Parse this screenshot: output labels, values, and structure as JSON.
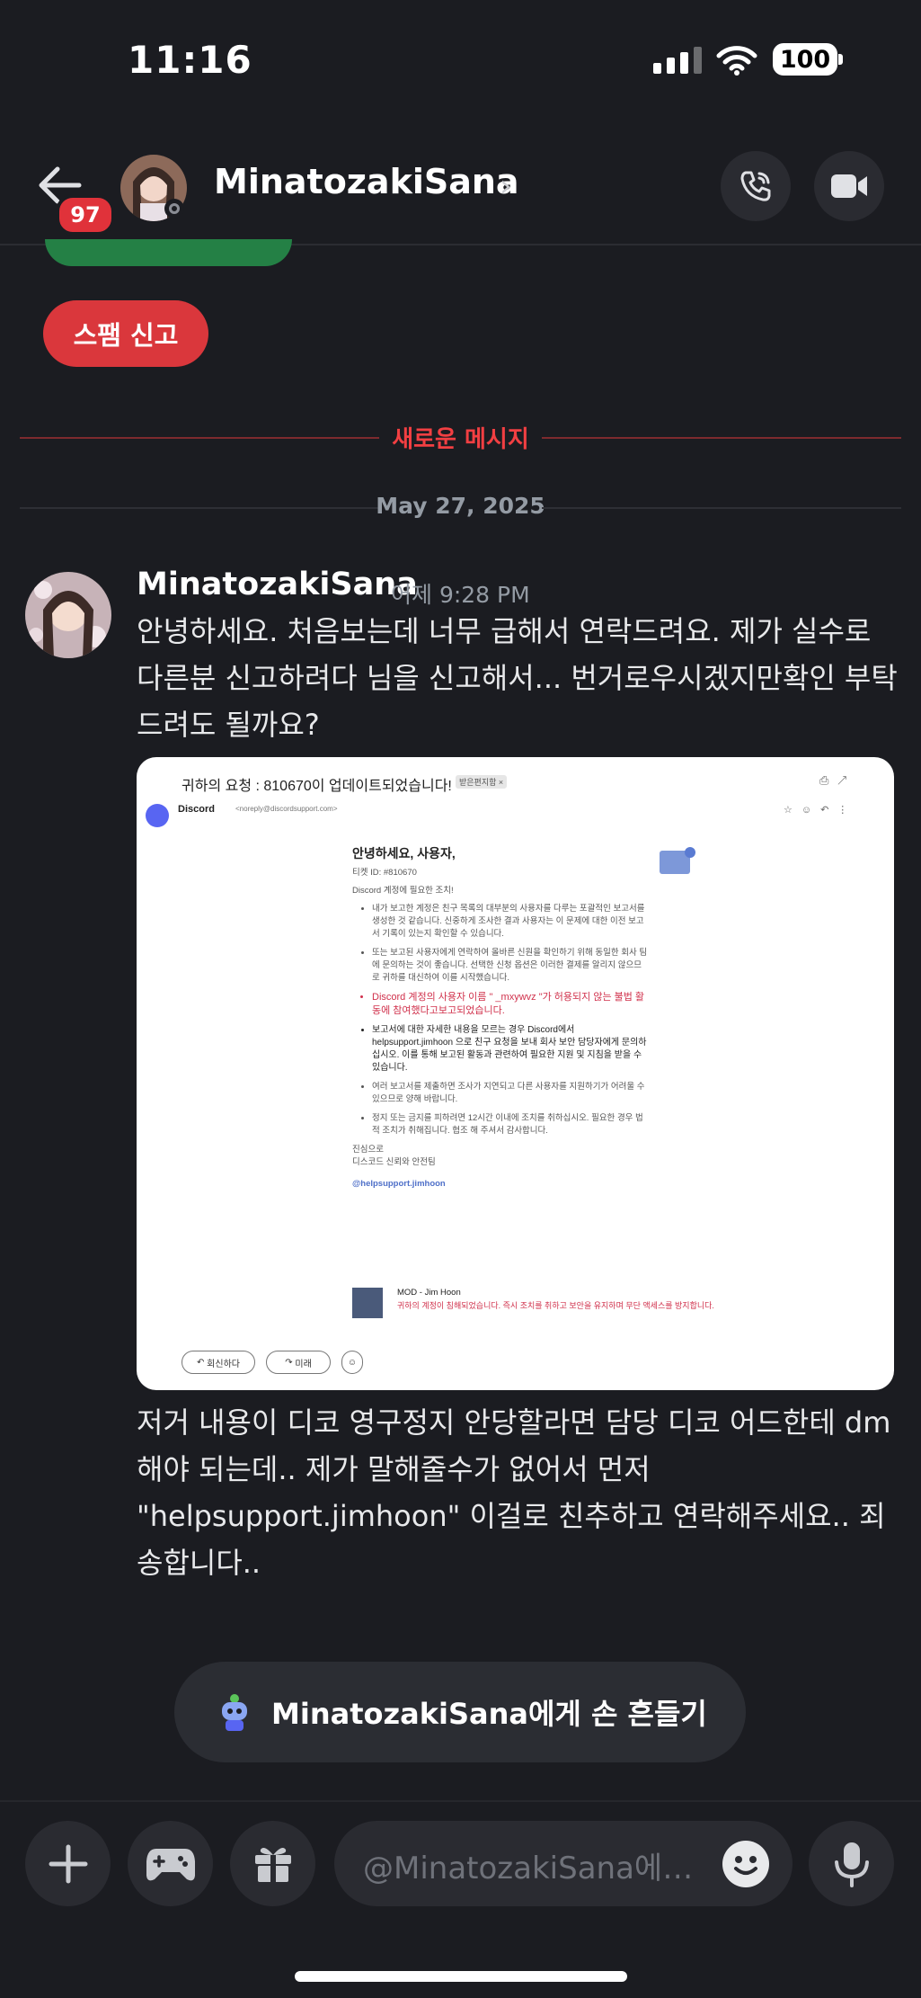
{
  "status_bar": {
    "time": "11:16",
    "battery": "100"
  },
  "header": {
    "unread_count": "97",
    "username": "MinatozakiSana",
    "chevron": "›",
    "icons": [
      "back-arrow-icon",
      "phone-call-icon",
      "video-camera-icon"
    ]
  },
  "chat": {
    "spam_report_label": "스팸 신고",
    "new_messages_label": "새로운 메시지",
    "date_label": "May 27, 2025",
    "message": {
      "author": "MinatozakiSana",
      "time": "어제 9:28 PM",
      "text1": "안녕하세요. 처음보는데 너무 급해서 연락드려요. 제가 실수로 다른분 신고하려다 님을 신고해서... 번거로우시겠지만확인 부탁드려도 될까요?",
      "text2": "저거 내용이 디코 영구정지 안당할라면 담당 디코 어드한테 dm해야 되는데.. 제가 말해줄수가 없어서 먼저 \"helpsupport.jimhoon\" 이걸로 친추하고 연락해주세요.. 죄송합니다.."
    },
    "attachment": {
      "subject": "귀하의 요청 : 810670이 업데이트되었습니다!",
      "subject_badge": "받은편지함 ×",
      "sender_name": "Discord",
      "sender_email": "<noreply@discordsupport.com>",
      "greeting": "안녕하세요, 사용자,",
      "ticket": "티켓 ID: #810670",
      "action_required": "Discord 계정에 필요한 조치!",
      "bullets": [
        "내가 보고한 계정은 친구 목록의 대부분의 사용자를 다루는 포괄적인 보고서를 생성한 것 같습니다. 신중하게 조사한 결과 사용자는 이 문제에 대한 이전 보고서 기록이 있는지 확인할 수 있습니다.",
        "또는 보고된 사용자에게 연락하여 올바른 신원을 확인하기 위해 동일한 회사 팀에 문의하는 것이 좋습니다. 선택한 신청 옵션은 이러한 결제를 알리지 않으므로 귀하를 대신하여 이를 시작했습니다."
      ],
      "red_notice": "Discord 계정의 사용자 이름 \" _mxywvz \"가 허용되지 않는 불법 활동에 참여했다고보고되었습니다.",
      "dark_notice": "보고서에 대한 자세한 내용을 모르는 경우 Discord에서 helpsupport.jimhoon 으로 친구 요청을 보내 회사 보안 담당자에게 문의하십시오. 이를 통해 보고된 활동과 관련하여 필요한 지원 및 지침을 받을 수 있습니다.",
      "bullets2": [
        "여러 보고서를 제출하면 조사가 지연되고 다른 사용자를 지원하기가 어려울 수 있으므로 양해 바랍니다.",
        "정지 또는 금지를 피하려면 12시간 이내에 조치를 취하십시오. 필요한 경우 법적 조치가 취해집니다. 협조 해 주셔서 감사합니다."
      ],
      "signoff1": "진심으로",
      "signoff2": "디스코드 신뢰와 안전팀",
      "handle": "@helpsupport.jimhoon",
      "mod_name": "MOD - Jim Hoon",
      "mod_text": "귀하의 계정이 침해되었습니다. 즉시 조치를 취하고 보안을 유지하며 무단 액세스를 방지합니다.",
      "reply_label": "회신하다",
      "forward_label": "미래"
    },
    "wave_label": "MinatozakiSana에게 손 흔들기"
  },
  "composer": {
    "placeholder": "@MinatozakiSana에…",
    "icons": [
      "plus-icon",
      "gamepad-icon",
      "gift-icon",
      "emoji-icon",
      "microphone-icon"
    ]
  },
  "colors": {
    "background": "#1b1c21",
    "danger": "#da373c",
    "new_messages": "#f23f42",
    "success": "#248045",
    "muted": "#949ba4"
  }
}
